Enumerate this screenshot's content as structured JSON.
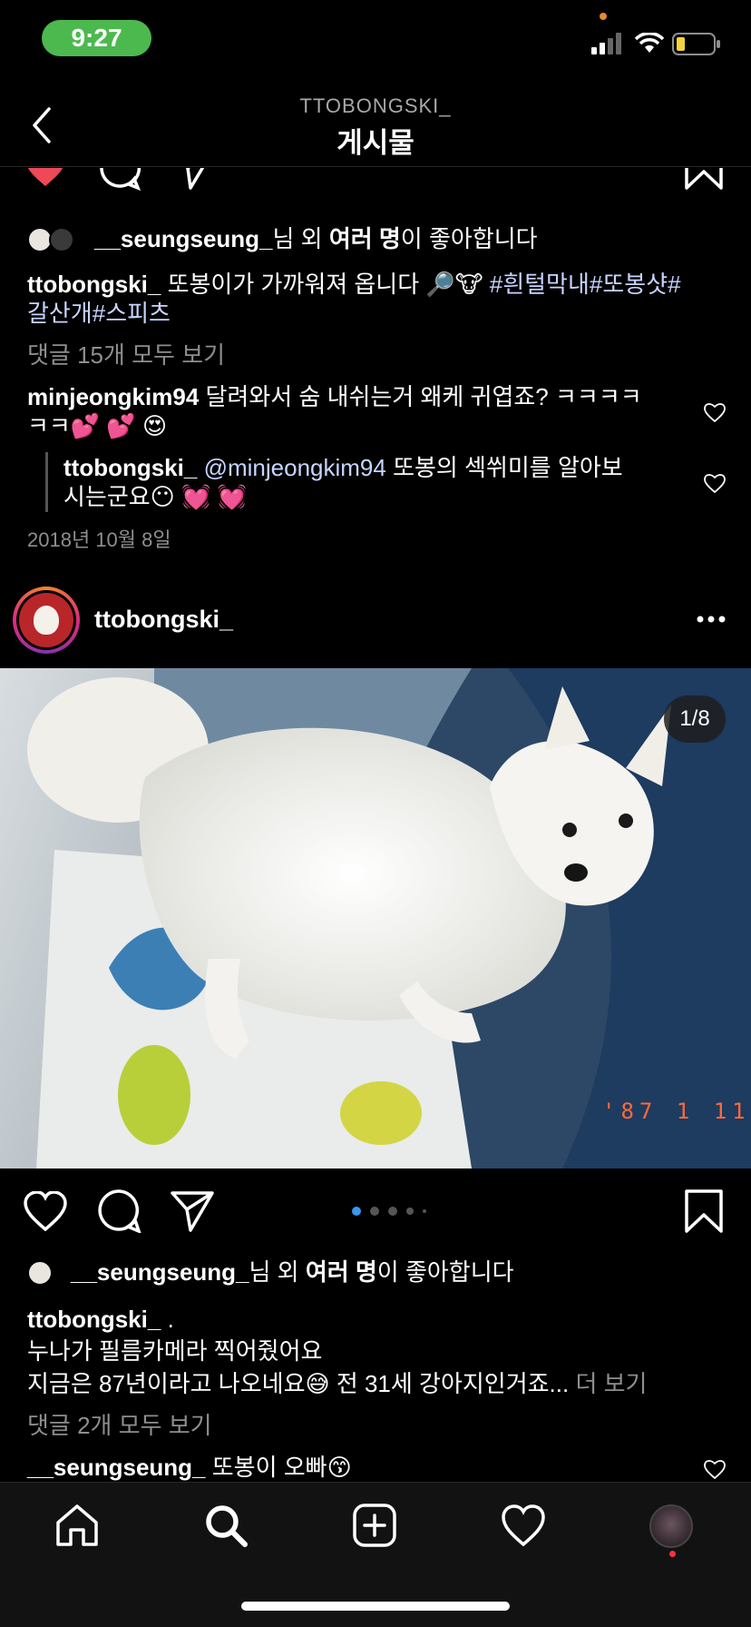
{
  "status_bar": {
    "time": "9:27",
    "battery_color": "#f4d33d",
    "time_pill_color": "#4cb94f"
  },
  "header": {
    "username": "TTOBONGSKI_",
    "title": "게시물"
  },
  "post1": {
    "likes": {
      "user": "__seungseung_",
      "suffix_1": "님 외 ",
      "bold": "여러 명",
      "suffix_2": "이 좋아합니다"
    },
    "caption": {
      "user": "ttobongski_",
      "text_line1": "또봉이가 가까워져 옵니다 🔎🐮 ",
      "hashtags_line1": "#흰털막내#또봉샷#",
      "hashtags_line2": "갈산개#스피츠"
    },
    "view_comments": "댓글 15개 모두 보기",
    "comment": {
      "user": "minjeongkim94",
      "text_line1": "달려와서 숨 내쉬는거 왜케 귀엽죠? ㅋㅋㅋㅋ",
      "text_line2": "ㅋㅋ💕 💕 😍"
    },
    "reply": {
      "user": "ttobongski_",
      "mention": "@minjeongkim94",
      "text_line1": " 또봉의 섹쒸미를 알아보",
      "text_line2": "시는군요😶 💓 💓"
    },
    "date": "2018년 10월 8일"
  },
  "post2": {
    "username": "ttobongski_",
    "more_icon": "more-horizontal-icon",
    "photo_counter": "1/8",
    "photo_date_stamp": "'87  1 11",
    "pager": {
      "total": 5,
      "active": 1,
      "active_color": "#3897f0"
    },
    "likes": {
      "user": "__seungseung_",
      "suffix_1": "님 외 ",
      "bold": "여러 명",
      "suffix_2": "이 좋아합니다"
    },
    "caption": {
      "user": "ttobongski_",
      "line0": " .",
      "line1": "누나가 필름카메라 찍어줬어요",
      "line2": "지금은 87년이라고 나오네요😅 전 31세 강아지인거죠...",
      "more": " 더 보기"
    },
    "view_comments": "댓글 2개 모두 보기",
    "comment": {
      "user": "__seungseung_",
      "text": " 또봉이 오빠😙"
    }
  },
  "tab_bar": {
    "items": [
      "home-icon",
      "search-icon",
      "new-post-icon",
      "activity-heart-icon",
      "profile-avatar"
    ]
  },
  "colors": {
    "like_red": "#ed4956",
    "background": "#000000",
    "muted": "#8e8e8e"
  }
}
